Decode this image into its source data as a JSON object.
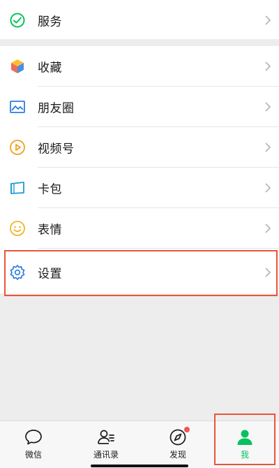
{
  "menu_top": [
    {
      "label": "服务",
      "icon": "services-icon"
    }
  ],
  "menu": [
    {
      "label": "收藏",
      "icon": "favorites-cube-icon"
    },
    {
      "label": "朋友圈",
      "icon": "moments-picture-icon"
    },
    {
      "label": "视频号",
      "icon": "channels-play-icon"
    },
    {
      "label": "卡包",
      "icon": "card-wallet-icon"
    },
    {
      "label": "表情",
      "icon": "sticker-smile-icon"
    },
    {
      "label": "设置",
      "icon": "settings-gear-icon"
    }
  ],
  "tabbar": {
    "tabs": [
      {
        "label": "微信",
        "icon": "chat-bubble-icon",
        "active": false
      },
      {
        "label": "通讯录",
        "icon": "contacts-icon",
        "active": false
      },
      {
        "label": "发现",
        "icon": "compass-icon",
        "active": false,
        "badge": "red-dot"
      },
      {
        "label": "我",
        "icon": "profile-person-icon",
        "active": true
      }
    ]
  },
  "colors": {
    "accent_green": "#07c160",
    "highlight_border": "#e8553a",
    "badge_red": "#fa5151",
    "background": "#ededed"
  }
}
